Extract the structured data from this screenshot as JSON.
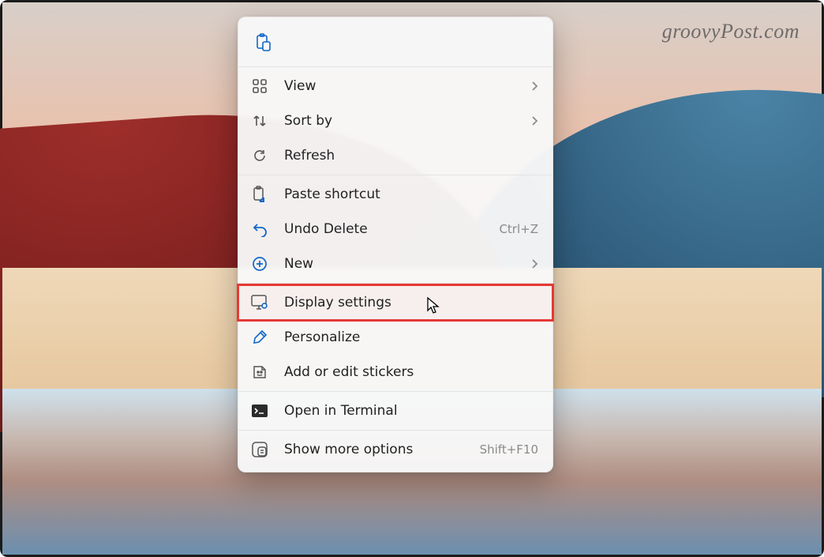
{
  "watermark": "groovyPost.com",
  "menu": {
    "toolbar": {
      "paste_icon": "clipboard-paste-icon"
    },
    "groups": [
      [
        {
          "id": "view",
          "label": "View",
          "hasSubmenu": true,
          "icon": "grid-icon"
        },
        {
          "id": "sortby",
          "label": "Sort by",
          "hasSubmenu": true,
          "icon": "sort-icon"
        },
        {
          "id": "refresh",
          "label": "Refresh",
          "icon": "refresh-icon"
        }
      ],
      [
        {
          "id": "paste-shortcut",
          "label": "Paste shortcut",
          "icon": "paste-shortcut-icon"
        },
        {
          "id": "undo-delete",
          "label": "Undo Delete",
          "shortcut": "Ctrl+Z",
          "icon": "undo-icon"
        },
        {
          "id": "new",
          "label": "New",
          "hasSubmenu": true,
          "icon": "new-plus-icon"
        }
      ],
      [
        {
          "id": "display-settings",
          "label": "Display settings",
          "icon": "display-settings-icon",
          "highlighted": true
        },
        {
          "id": "personalize",
          "label": "Personalize",
          "icon": "paintbrush-icon"
        },
        {
          "id": "stickers",
          "label": "Add or edit stickers",
          "icon": "sticker-icon"
        }
      ],
      [
        {
          "id": "open-terminal",
          "label": "Open in Terminal",
          "icon": "terminal-icon"
        }
      ],
      [
        {
          "id": "show-more",
          "label": "Show more options",
          "shortcut": "Shift+F10",
          "icon": "more-options-icon"
        }
      ]
    ]
  }
}
